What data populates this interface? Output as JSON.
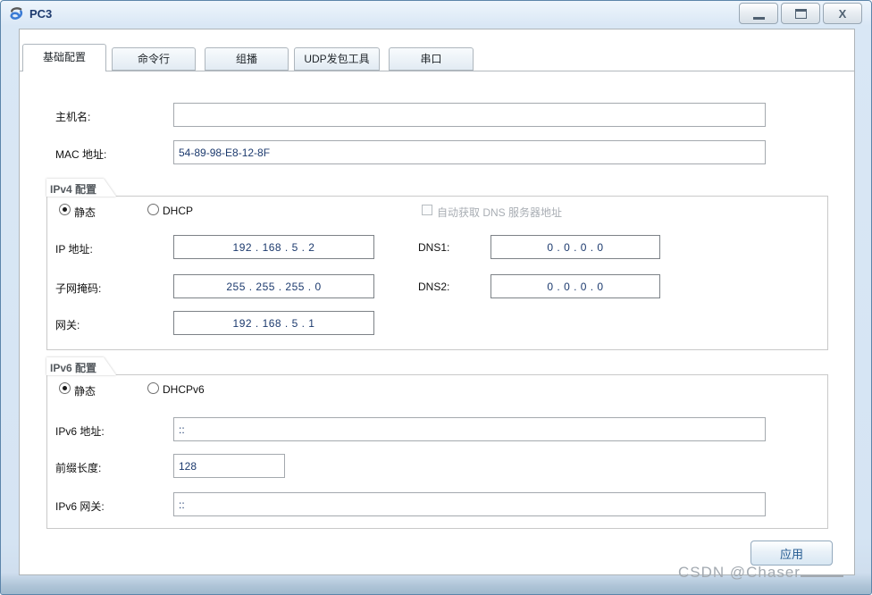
{
  "window": {
    "title": "PC3",
    "icons": {
      "app": "ensp-logo",
      "minimize": "_",
      "maximize": "❐",
      "close": "X"
    }
  },
  "tabs": [
    {
      "label": "基础配置",
      "active": true
    },
    {
      "label": "命令行",
      "active": false
    },
    {
      "label": "组播",
      "active": false
    },
    {
      "label": "UDP发包工具",
      "active": false
    },
    {
      "label": "串口",
      "active": false
    }
  ],
  "basic": {
    "hostname_label": "主机名:",
    "hostname_value": "",
    "mac_label": "MAC 地址:",
    "mac_value": "54-89-98-E8-12-8F"
  },
  "ipv4": {
    "group_label": "IPv4 配置",
    "static_label": "静态",
    "static_selected": true,
    "dhcp_label": "DHCP",
    "dhcp_selected": false,
    "dns_auto_label": "自动获取 DNS 服务器地址",
    "dns_auto_checked": false,
    "dns_auto_enabled": false,
    "ip_label": "IP 地址:",
    "ip_value": "192 . 168 . 5 . 2",
    "mask_label": "子网掩码:",
    "mask_value": "255 . 255 . 255 . 0",
    "gateway_label": "网关:",
    "gateway_value": "192 . 168 . 5 . 1",
    "dns1_label": "DNS1:",
    "dns1_value": "0 . 0 . 0 . 0",
    "dns2_label": "DNS2:",
    "dns2_value": "0 . 0 . 0 . 0"
  },
  "ipv6": {
    "group_label": "IPv6 配置",
    "static_label": "静态",
    "static_selected": true,
    "dhcpv6_label": "DHCPv6",
    "dhcpv6_selected": false,
    "address_label": "IPv6 地址:",
    "address_value": "::",
    "prefix_label": "前缀长度:",
    "prefix_value": "128",
    "gateway_label": "IPv6 网关:",
    "gateway_value": "::"
  },
  "apply_label": "应用",
  "watermark": "CSDN @Chaser",
  "colors": {
    "frame_border": "#5c85aa",
    "titlebar_top": "#eef5fc",
    "titlebar_bottom": "#d5e4f3",
    "title_text": "#1c3a6e",
    "field_text": "#1c3a6e",
    "group_border": "#c9c9c9",
    "disabled_text": "#a9aeb4",
    "apply_text": "#235a91",
    "watermark_text": "#a2a9b0",
    "logo_blue": "#3a7bd5"
  }
}
